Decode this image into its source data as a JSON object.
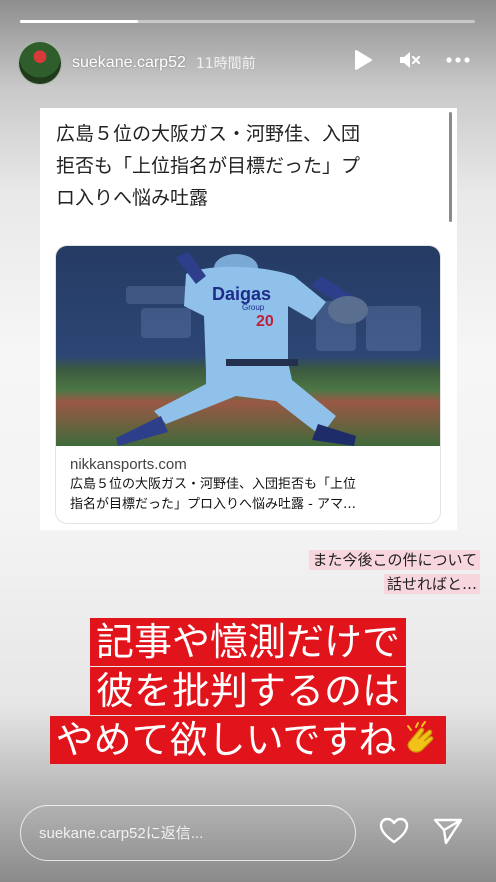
{
  "story": {
    "progress": 0.26,
    "username": "suekane.carp52",
    "time_ago": "11時間前"
  },
  "header_icons": [
    "play-icon",
    "mute-icon",
    "more-icon"
  ],
  "article": {
    "headline_lines": [
      "広島５位の大阪ガス・河野佳、入団",
      "拒否も「上位指名が目標だった」プ",
      "ロ入りへ悩み吐露"
    ],
    "link_domain": "nikkansports.com",
    "link_title_lines": [
      "広島５位の大阪ガス・河野佳、入団拒否も「上位",
      "指名が目標だった」プロ入りへ悩み吐露 - アマ…"
    ],
    "photo_text": {
      "jersey_name": "Daigas",
      "jersey_sub": "Group",
      "jersey_number": "20"
    }
  },
  "caption_pink": [
    "また今後この件について",
    "話せればと…"
  ],
  "caption_red": [
    "記事や憶測だけで",
    "彼を批判するのは",
    "やめて欲しいですね"
  ],
  "footer": {
    "reply_placeholder": "suekane.carp52に返信..."
  },
  "colors": {
    "red_highlight": "#e1131b",
    "pink_highlight": "#f7d6dd"
  }
}
